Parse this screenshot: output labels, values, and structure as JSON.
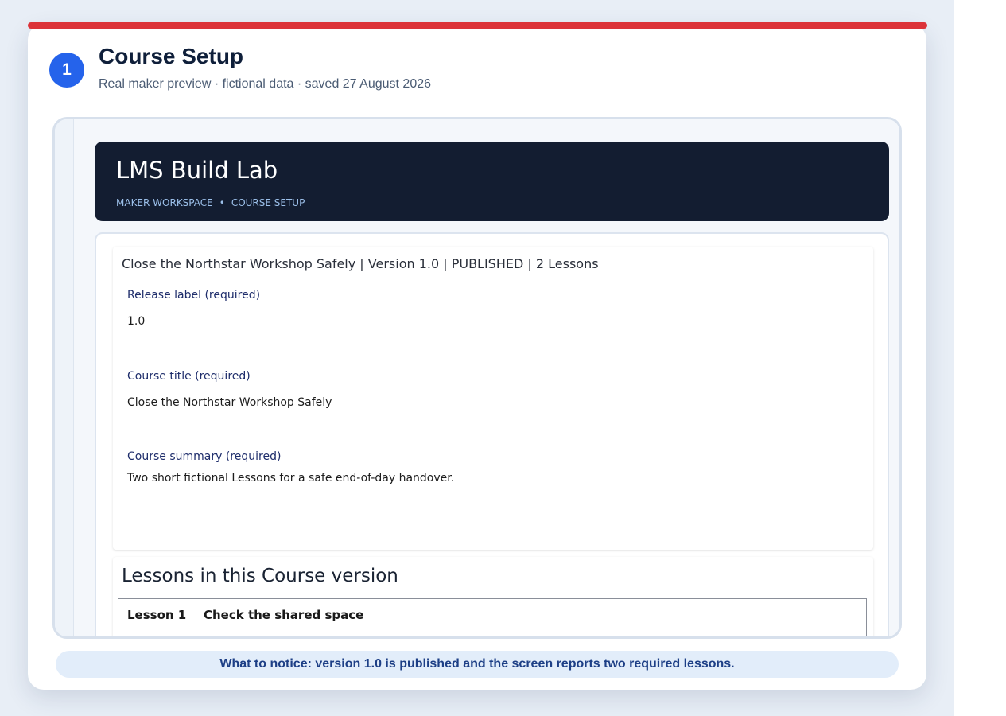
{
  "step": {
    "number": "1",
    "title": "Course Setup",
    "subtitle": "Real maker preview · fictional data · saved 27 August 2026"
  },
  "app": {
    "title": "LMS Build Lab",
    "breadcrumb": [
      "MAKER WORKSPACE",
      "•",
      "COURSE SETUP"
    ]
  },
  "course": {
    "summary_line": "Close the Northstar Workshop Safely | Version 1.0 | PUBLISHED | 2 Lessons",
    "fields": [
      {
        "label": "Release label (required)",
        "value": "1.0"
      },
      {
        "label": "Course title (required)",
        "value": "Close the Northstar Workshop Safely"
      },
      {
        "label": "Course summary (required)",
        "value": "Two short fictional Lessons for a safe end-of-day handover."
      }
    ]
  },
  "lessons": {
    "title": "Lessons in this Course version",
    "rows": [
      {
        "number": "Lesson 1",
        "name": "Check the shared space"
      }
    ]
  },
  "notice": "What to notice: version 1.0 is published and the screen reports two required lessons.",
  "colors": {
    "accent_bar": "#dc3339",
    "badge": "#2563eb",
    "app_header": "#131d31"
  }
}
